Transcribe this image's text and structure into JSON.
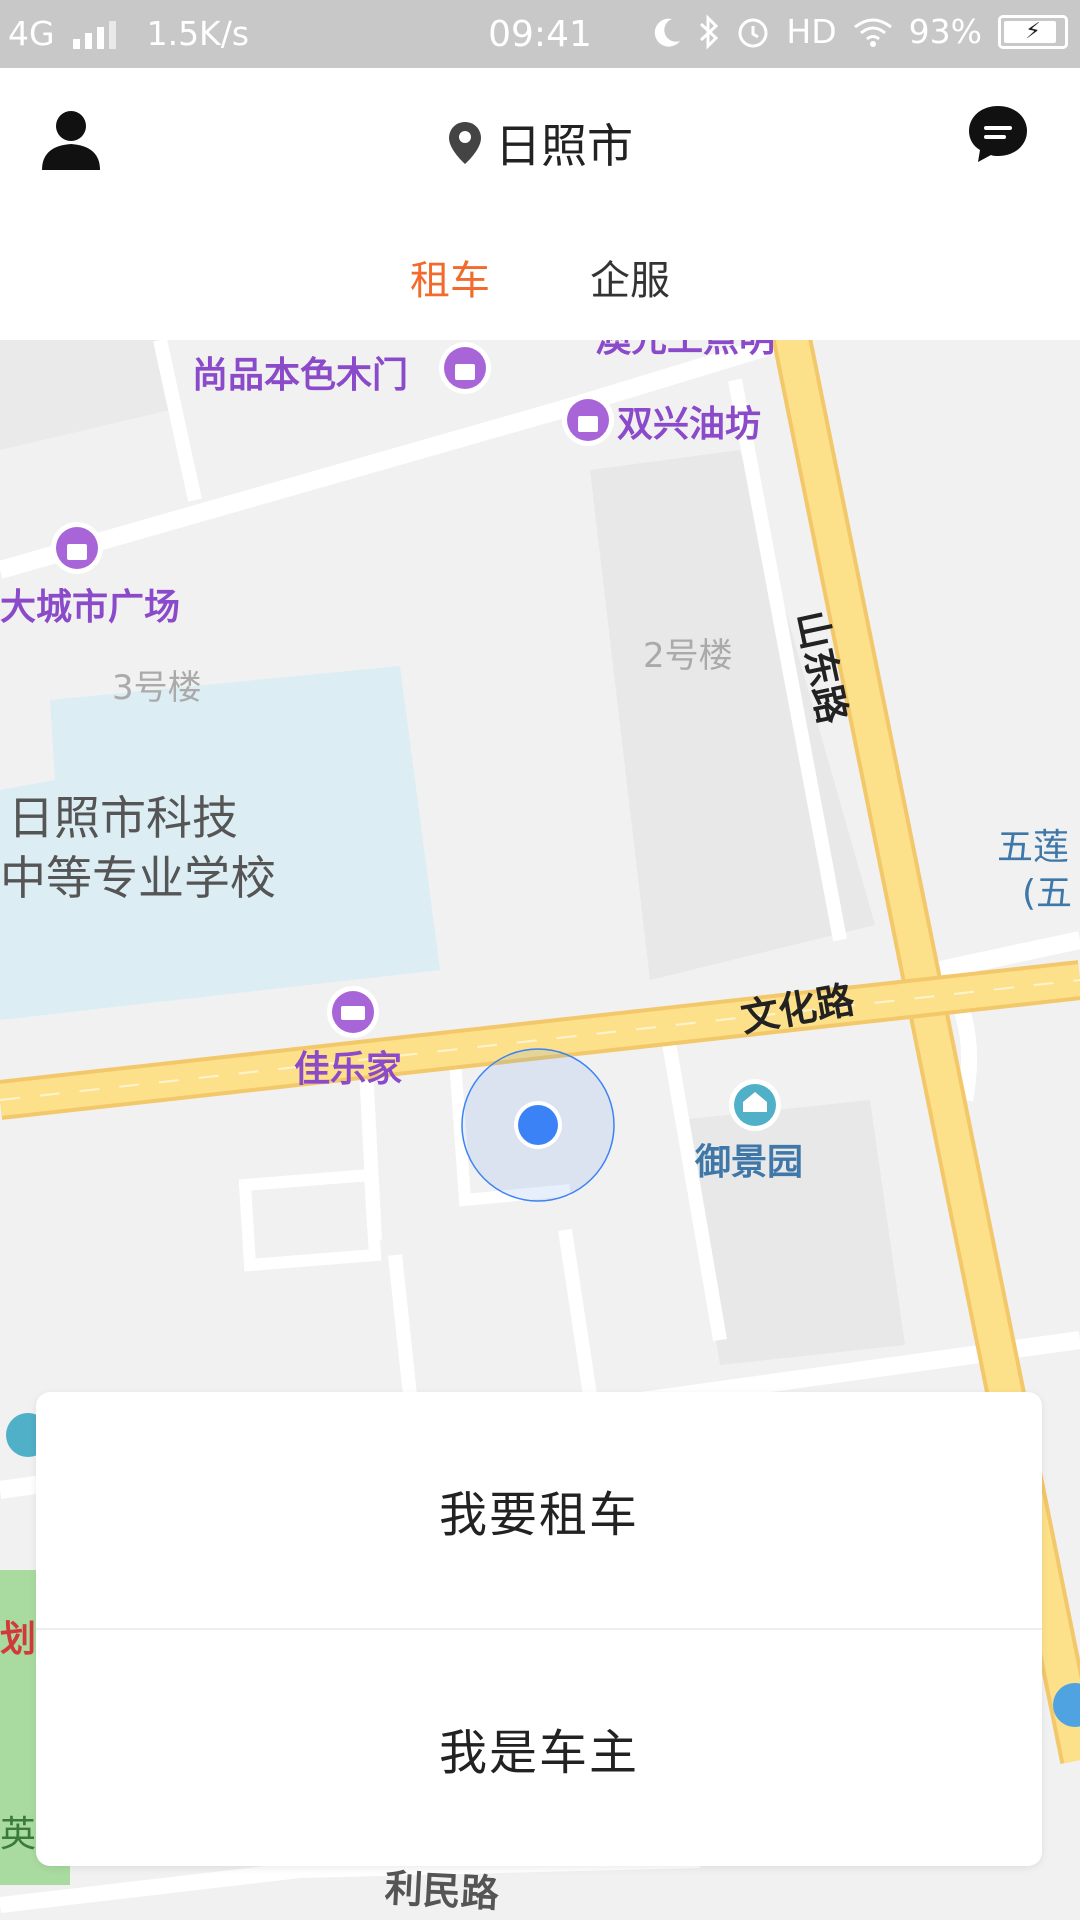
{
  "status_bar": {
    "network": "4G",
    "speed": "1.5K/s",
    "time": "09:41",
    "hd": "HD",
    "battery": "93%"
  },
  "header": {
    "city": "日照市",
    "tabs": [
      {
        "label": "租车",
        "active": true
      },
      {
        "label": "企服",
        "active": false
      }
    ]
  },
  "map": {
    "poi": {
      "shangpin": "尚品本色木门",
      "shuangxing": "双兴油坊",
      "dacheng": "大城市广场",
      "jialejia": "佳乐家",
      "yujingyuan": "御景园",
      "top_cut": "澳元工点明"
    },
    "buildings": {
      "b3": "3号楼",
      "b2": "2号楼"
    },
    "school": {
      "line1": "日照市科技",
      "line2": "中等专业学校"
    },
    "roads": {
      "shandong": "山东路",
      "wenhua": "文化路",
      "limin": "利民路"
    },
    "edge": {
      "wulian1": "五莲",
      "wulian2": "(五",
      "red": "划",
      "ying": "英"
    }
  },
  "options": {
    "rent": "我要租车",
    "owner": "我是车主"
  },
  "colors": {
    "accent": "#f36b2c",
    "poi": "#8a4ac9",
    "road": "#fde08a",
    "location": "#3b82f6"
  }
}
